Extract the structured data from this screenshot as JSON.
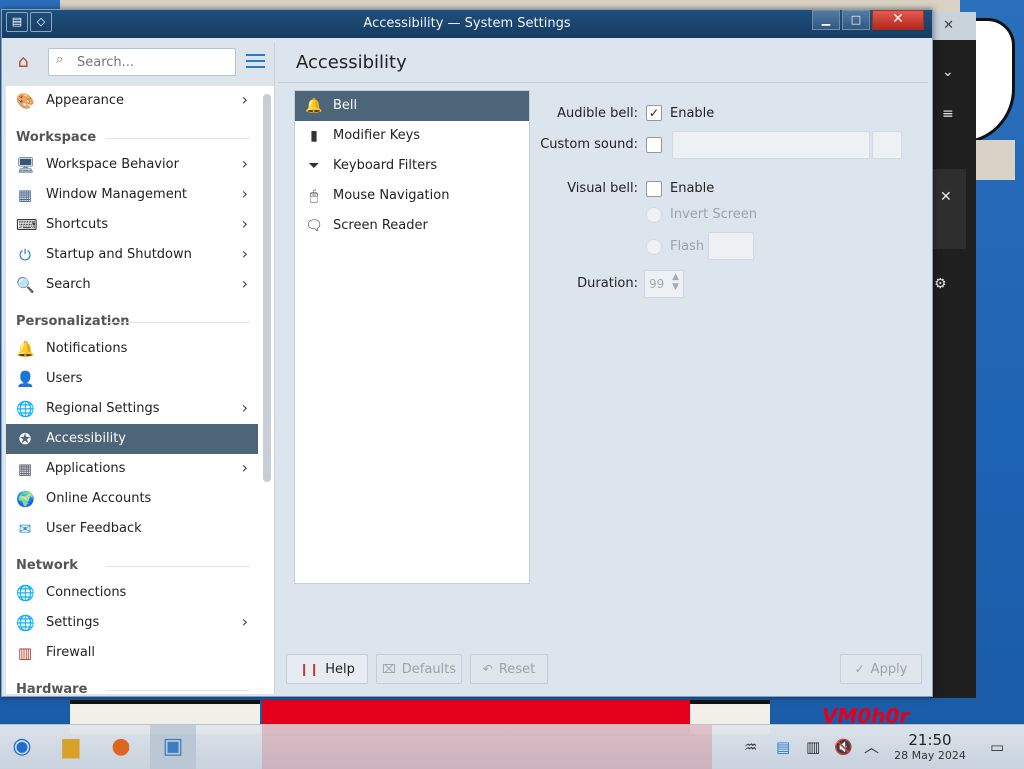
{
  "window": {
    "title": "Accessibility — System Settings"
  },
  "sidebar": {
    "search_placeholder": "Search...",
    "items": [
      {
        "type": "item",
        "label": "Appearance",
        "icon": "appearance-icon",
        "chev": true
      },
      {
        "type": "section",
        "label": "Workspace"
      },
      {
        "type": "item",
        "label": "Workspace Behavior",
        "icon": "workspace-behavior-icon",
        "chev": true
      },
      {
        "type": "item",
        "label": "Window Management",
        "icon": "window-management-icon",
        "chev": true
      },
      {
        "type": "item",
        "label": "Shortcuts",
        "icon": "keyboard-icon",
        "chev": true
      },
      {
        "type": "item",
        "label": "Startup and Shutdown",
        "icon": "startup-icon",
        "chev": true
      },
      {
        "type": "item",
        "label": "Search",
        "icon": "search-icon",
        "chev": true
      },
      {
        "type": "section",
        "label": "Personalization"
      },
      {
        "type": "item",
        "label": "Notifications",
        "icon": "bell-icon",
        "chev": false
      },
      {
        "type": "item",
        "label": "Users",
        "icon": "user-icon",
        "chev": false
      },
      {
        "type": "item",
        "label": "Regional Settings",
        "icon": "globe-icon",
        "chev": true
      },
      {
        "type": "item",
        "label": "Accessibility",
        "icon": "accessibility-icon",
        "chev": false,
        "active": true
      },
      {
        "type": "item",
        "label": "Applications",
        "icon": "applications-icon",
        "chev": true
      },
      {
        "type": "item",
        "label": "Online Accounts",
        "icon": "online-accounts-icon",
        "chev": false
      },
      {
        "type": "item",
        "label": "User Feedback",
        "icon": "feedback-icon",
        "chev": false
      },
      {
        "type": "section",
        "label": "Network"
      },
      {
        "type": "item",
        "label": "Connections",
        "icon": "network-icon",
        "chev": false
      },
      {
        "type": "item",
        "label": "Settings",
        "icon": "network-settings-icon",
        "chev": true
      },
      {
        "type": "item",
        "label": "Firewall",
        "icon": "firewall-icon",
        "chev": false
      },
      {
        "type": "section",
        "label": "Hardware"
      }
    ]
  },
  "content": {
    "title": "Accessibility",
    "list": [
      "Bell",
      "Modifier Keys",
      "Keyboard Filters",
      "Mouse Navigation",
      "Screen Reader"
    ],
    "form": {
      "audible_bell_label": "Audible bell:",
      "audible_enable": "Enable",
      "custom_sound_label": "Custom sound:",
      "visual_bell_label": "Visual bell:",
      "visual_enable": "Enable",
      "invert_screen": "Invert Screen",
      "flash": "Flash",
      "duration_label": "Duration:",
      "duration_value": "99"
    },
    "buttons": {
      "help": "Help",
      "defaults": "Defaults",
      "reset": "Reset",
      "apply": "Apply"
    }
  },
  "taskbar": {
    "time": "21:50",
    "date": "28 May 2024"
  }
}
